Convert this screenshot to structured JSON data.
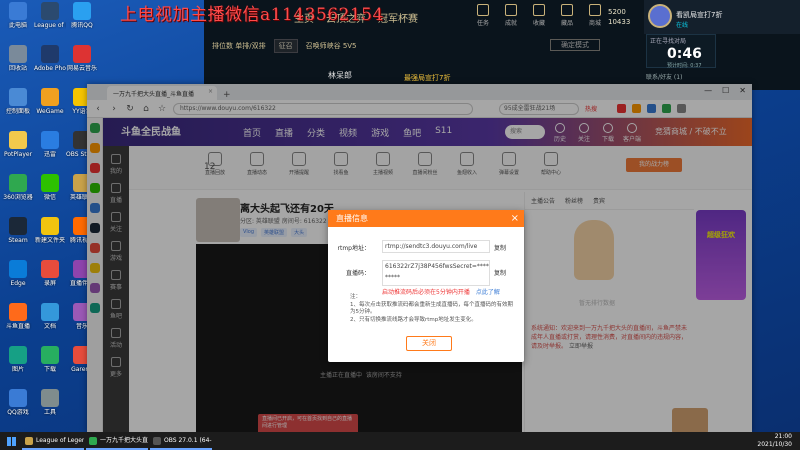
{
  "overlay_text": "上电视加主播微信a1143562154",
  "desktop": {
    "icons": [
      {
        "label": "此电脑",
        "color": "#3a7bd5"
      },
      {
        "label": "League of Legends",
        "color": "#2b4a6f"
      },
      {
        "label": "腾讯QQ",
        "color": "#2aa0f0"
      },
      {
        "label": "回收站",
        "color": "#7a8a9a"
      },
      {
        "label": "Adobe Photoshop",
        "color": "#1f3a6b"
      },
      {
        "label": "网易云音乐",
        "color": "#d33"
      },
      {
        "label": "控制面板",
        "color": "#4a8ad5"
      },
      {
        "label": "WeGame",
        "color": "#f0a020"
      },
      {
        "label": "YY语音",
        "color": "#f5c400"
      },
      {
        "label": "PotPlayer",
        "color": "#f2c94c"
      },
      {
        "label": "迅雷",
        "color": "#2a7de1"
      },
      {
        "label": "OBS Studio",
        "color": "#333"
      },
      {
        "label": "360浏览器",
        "color": "#2fa84f"
      },
      {
        "label": "微信",
        "color": "#2dc100"
      },
      {
        "label": "英雄联盟",
        "color": "#c9a24a"
      },
      {
        "label": "Steam",
        "color": "#1b2838"
      },
      {
        "label": "新建文件夹",
        "color": "#f1c40f"
      },
      {
        "label": "腾讯视频",
        "color": "#ff6a00"
      },
      {
        "label": "Edge",
        "color": "#0a7cd8"
      },
      {
        "label": "录屏",
        "color": "#e74c3c"
      },
      {
        "label": "直播伴侣",
        "color": "#8e44ad"
      },
      {
        "label": "斗鱼直播",
        "color": "#ff6a1a"
      },
      {
        "label": "文档",
        "color": "#3498db"
      },
      {
        "label": "音乐",
        "color": "#9b59b6"
      },
      {
        "label": "图片",
        "color": "#16a085"
      },
      {
        "label": "下载",
        "color": "#27ae60"
      },
      {
        "label": "Garena",
        "color": "#e74c3c"
      },
      {
        "label": "QQ游戏",
        "color": "#3a7bd5"
      },
      {
        "label": "工具",
        "color": "#7f8c8d"
      }
    ]
  },
  "lol_client": {
    "nav": [
      "主页",
      "云顶之弈",
      "冠军杯赛"
    ],
    "right_icons": [
      "任务",
      "成就",
      "收藏",
      "藏品",
      "商城"
    ],
    "rp": {
      "line1": "5200",
      "line2": "10433"
    },
    "queue_label": "排位数 单排/双排",
    "mode_label": "征召",
    "map_label": "召唤师峡谷 5V5",
    "confirm_btn": "确定模式",
    "player_name": "林呆郎",
    "tip": "最强局宣打7折"
  },
  "profile": {
    "name": "看凯局宣打7折",
    "status": "在线",
    "timer_header": "正在寻找对局",
    "timer_value": "0:46",
    "timer_sub": "预计时间: 0:37",
    "friends": "联系/好友 (1)"
  },
  "browser": {
    "tab_title": "一万九千把大头直播_斗鱼直播",
    "url": "https://www.douyu.com/616322",
    "search_text": "95成全雷狂战21场",
    "hot_label": "热搜",
    "controls": [
      "—",
      "☐",
      "✕"
    ]
  },
  "douyu": {
    "logo": "斗鱼全民战鱼",
    "nav": [
      "首页",
      "直播",
      "分类",
      "视频",
      "游戏",
      "鱼吧",
      "S11"
    ],
    "search_placeholder": "搜索",
    "header_icons": [
      "历史",
      "关注",
      "下载",
      "客户端"
    ],
    "user_text": "竞猜商城 / 不破不立",
    "sidebar": [
      "我的",
      "直播",
      "关注",
      "游戏",
      "赛事",
      "鱼吧",
      "活动",
      "更多"
    ],
    "level": "12",
    "sub_items": [
      "直播回放",
      "直播动态",
      "开播提醒",
      "找看鱼",
      "主播视频",
      "直播间粉丝",
      "鱼翅收入",
      "弹幕设置",
      "帮助中心"
    ],
    "room_title": "离大头起飞还有20天",
    "room_meta": "分区: 英雄联盟  房间号: 616322  主播: 一万九千把大头",
    "tags": [
      "Vlog",
      "英雄联盟",
      "大头"
    ],
    "right_tabs": [
      "主播公告",
      "粉丝榜",
      "贵宾"
    ],
    "right_top_btn": "我的战力榜",
    "rank_empty": "暂无排行数据",
    "chat_system": "系统通知：欢迎来到一万九千把大头的直播间，斗鱼严禁未成年人直播或打赏，请理性消费，对直播间内的违规内容，请及时举报。",
    "chat_link": "立即举报",
    "promo": "超级狂欢",
    "player_texts": [
      "主播正在直播中",
      "该房间不支持"
    ],
    "toast": "直播间已开启，可在首页找到自己的直播间进行管理"
  },
  "modal": {
    "title": "直播信息",
    "rtmp_label": "rtmp地址：",
    "rtmp_value": "rtmp://sendtc3.douyu.com/live",
    "key_label": "直播码：",
    "key_value": "616322rZ7j38P456fwsSecret=*********",
    "copy_label": "复制",
    "warn_text": "启动推流码后必须在5分钟内开播",
    "warn_link": "点此了解",
    "note_title": "注：",
    "note_1": "1、每次点击获取推流码都会重新生成直播码，每个直播码的有效期为5分钟。",
    "note_2": "2、只有切换推流线路才会导致rtmp地址发生变化。",
    "close_label": "关闭"
  },
  "taskbar": {
    "items": [
      {
        "label": "League of Legends",
        "color": "#c9a24a"
      },
      {
        "label": "一万九千把大头直播",
        "color": "#2fa84f"
      },
      {
        "label": "OBS 27.0.1 (64-bit)",
        "color": "#555"
      }
    ],
    "time": "21:00",
    "date": "2021/10/30"
  }
}
